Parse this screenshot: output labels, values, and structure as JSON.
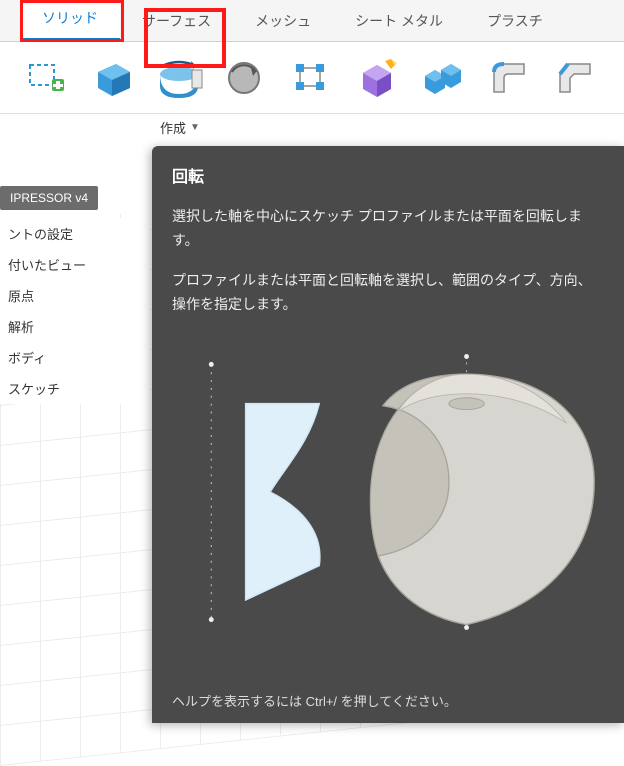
{
  "tabs": {
    "solid": "ソリッド",
    "surface": "サーフェス",
    "mesh": "メッシュ",
    "sheetmetal": "シート メタル",
    "plastic": "プラスチ"
  },
  "section": {
    "create": "作成"
  },
  "browser": {
    "doc_name": "IPRESSOR v4",
    "items": {
      "doc_settings": "ントの設定",
      "named_views": "付いたビュー",
      "origin": "原点",
      "analysis": "解析",
      "bodies": "ボディ",
      "sketches": "スケッチ"
    }
  },
  "tooltip": {
    "title": "回転",
    "p1": "選択した軸を中心にスケッチ プロファイルまたは平面を回転します。",
    "p2": "プロファイルまたは平面と回転軸を選択し、範囲のタイプ、方向、操作を指定します。",
    "help": "ヘルプを表示するには Ctrl+/ を押してください。"
  }
}
